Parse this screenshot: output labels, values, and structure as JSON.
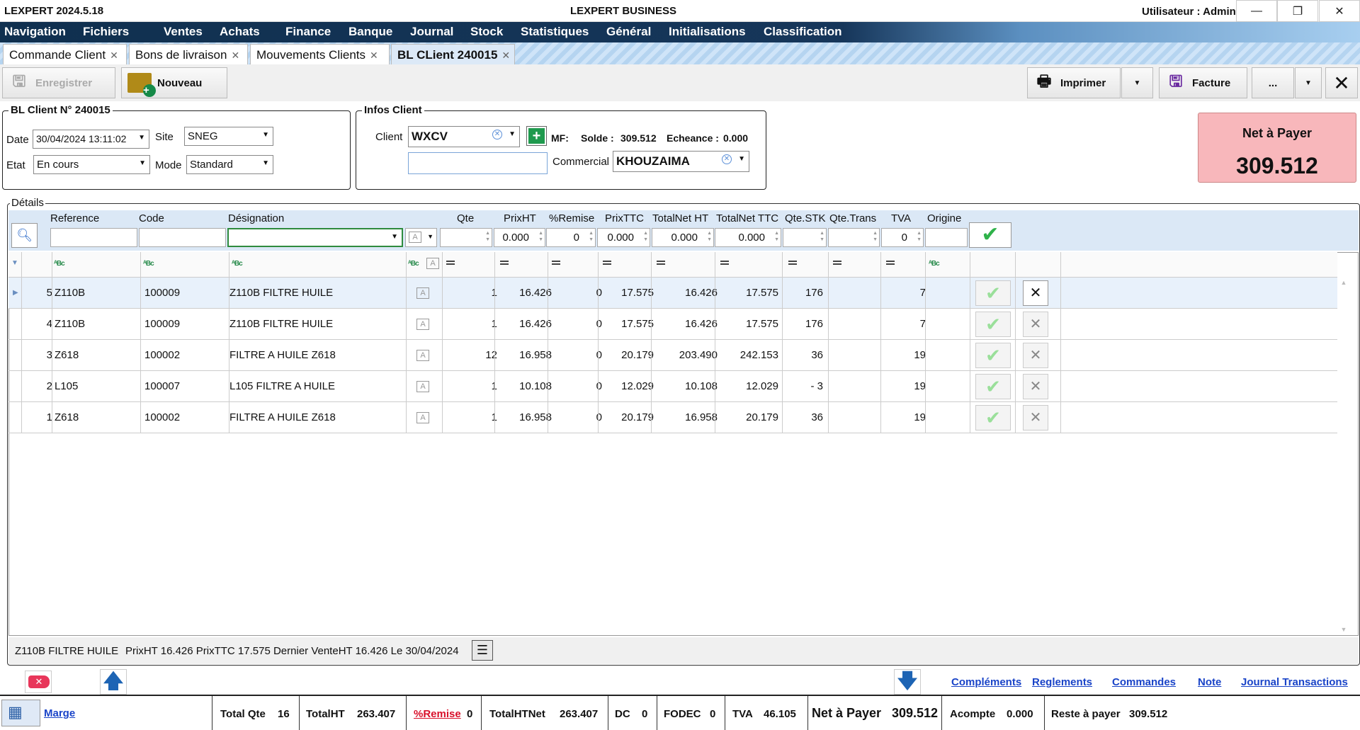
{
  "window": {
    "app_title": "LEXPERT 2024.5.18",
    "center_title": "LEXPERT BUSINESS",
    "user_label": "Utilisateur : Admin",
    "minimize": "—",
    "restore": "❐",
    "close": "✕"
  },
  "menu": [
    "Navigation",
    "Fichiers",
    "Ventes",
    "Achats",
    "Finance",
    "Banque",
    "Journal",
    "Stock",
    "Statistiques",
    "Général",
    "Initialisations",
    "Classification"
  ],
  "tabs": [
    {
      "label": "Commande Client",
      "active": false
    },
    {
      "label": "Bons de livraison",
      "active": false
    },
    {
      "label": "Mouvements Clients",
      "active": false
    },
    {
      "label": "BL CLient 240015",
      "active": true
    }
  ],
  "toolbar": {
    "save": "Enregistrer",
    "new": "Nouveau",
    "print": "Imprimer",
    "invoice": "Facture",
    "more": "..."
  },
  "bl": {
    "title": "BL Client N° 240015",
    "date_label": "Date",
    "date": "30/04/2024 13:11:02",
    "site_label": "Site",
    "site": "SNEG",
    "etat_label": "Etat",
    "etat": "En cours",
    "mode_label": "Mode",
    "mode": "Standard"
  },
  "client": {
    "title": "Infos Client",
    "client_label": "Client",
    "client": "WXCV",
    "mf_label": "MF:",
    "solde_label": "Solde :",
    "solde": "309.512",
    "echeance_label": "Echeance :",
    "echeance": "0.000",
    "commercial_label": "Commercial",
    "commercial": "KHOUZAIMA",
    "extra": ""
  },
  "net": {
    "label": "Net à Payer",
    "value": "309.512"
  },
  "details": {
    "title": "Détails",
    "headers": {
      "ref": "Reference",
      "code": "Code",
      "des": "Désignation",
      "qte": "Qte",
      "prixht": "PrixHT",
      "remise": "%Remise",
      "prixttc": "PrixTTC",
      "totht": "TotalNet HT",
      "totttc": "TotalNet TTC",
      "stk": "Qte.STK",
      "trans": "Qte.Trans",
      "tva": "TVA",
      "origine": "Origine"
    },
    "entry": {
      "prixht": "0.000",
      "remise": "0",
      "prixttc": "0.000",
      "totht": "0.000",
      "totttc": "0.000",
      "tva": "0"
    },
    "rows": [
      {
        "n": "5",
        "ref": "Z110B",
        "code": "100009",
        "des": "Z110B FILTRE  HUILE",
        "qte": "1",
        "prixht": "16.426",
        "remise": "0",
        "prixttc": "17.575",
        "totht": "16.426",
        "totttc": "17.575",
        "stk": "176",
        "tva": "7"
      },
      {
        "n": "4",
        "ref": "Z110B",
        "code": "100009",
        "des": "Z110B FILTRE  HUILE",
        "qte": "1",
        "prixht": "16.426",
        "remise": "0",
        "prixttc": "17.575",
        "totht": "16.426",
        "totttc": "17.575",
        "stk": "176",
        "tva": "7"
      },
      {
        "n": "3",
        "ref": "Z618",
        "code": "100002",
        "des": "FILTRE A HUILE Z618",
        "qte": "12",
        "prixht": "16.958",
        "remise": "0",
        "prixttc": "20.179",
        "totht": "203.490",
        "totttc": "242.153",
        "stk": "36",
        "tva": "19"
      },
      {
        "n": "2",
        "ref": "L105",
        "code": "100007",
        "des": "L105 FILTRE A HUILE",
        "qte": "1",
        "prixht": "10.108",
        "remise": "0",
        "prixttc": "12.029",
        "totht": "10.108",
        "totttc": "12.029",
        "stk": "- 3",
        "tva": "19"
      },
      {
        "n": "1",
        "ref": "Z618",
        "code": "100002",
        "des": "FILTRE A HUILE Z618",
        "qte": "1",
        "prixht": "16.958",
        "remise": "0",
        "prixttc": "20.179",
        "totht": "16.958",
        "totttc": "20.179",
        "stk": "36",
        "tva": "19"
      }
    ],
    "info": {
      "product": "Z110B FILTRE  HUILE",
      "prices": "PrixHT 16.426 PrixTTC 17.575  Dernier VenteHT 16.426  Le 30/04/2024"
    }
  },
  "links": [
    "Compléments",
    "Reglements",
    "Commandes",
    "Note",
    "Journal Transactions"
  ],
  "totals": {
    "marge": "Marge",
    "qte_label": "Total Qte",
    "qte": "16",
    "ht_label": "TotalHT",
    "ht": "263.407",
    "remise_label": "%Remise",
    "remise": "0",
    "htnet_label": "TotalHTNet",
    "htnet": "263.407",
    "dc_label": "DC",
    "dc": "0",
    "fodec_label": "FODEC",
    "fodec": "0",
    "tva_label": "TVA",
    "tva": "46.105",
    "net_label": "Net à Payer",
    "net": "309.512",
    "acompte_label": "Acompte",
    "acompte": "0.000",
    "reste_label": "Reste à payer",
    "reste": "309.512"
  }
}
